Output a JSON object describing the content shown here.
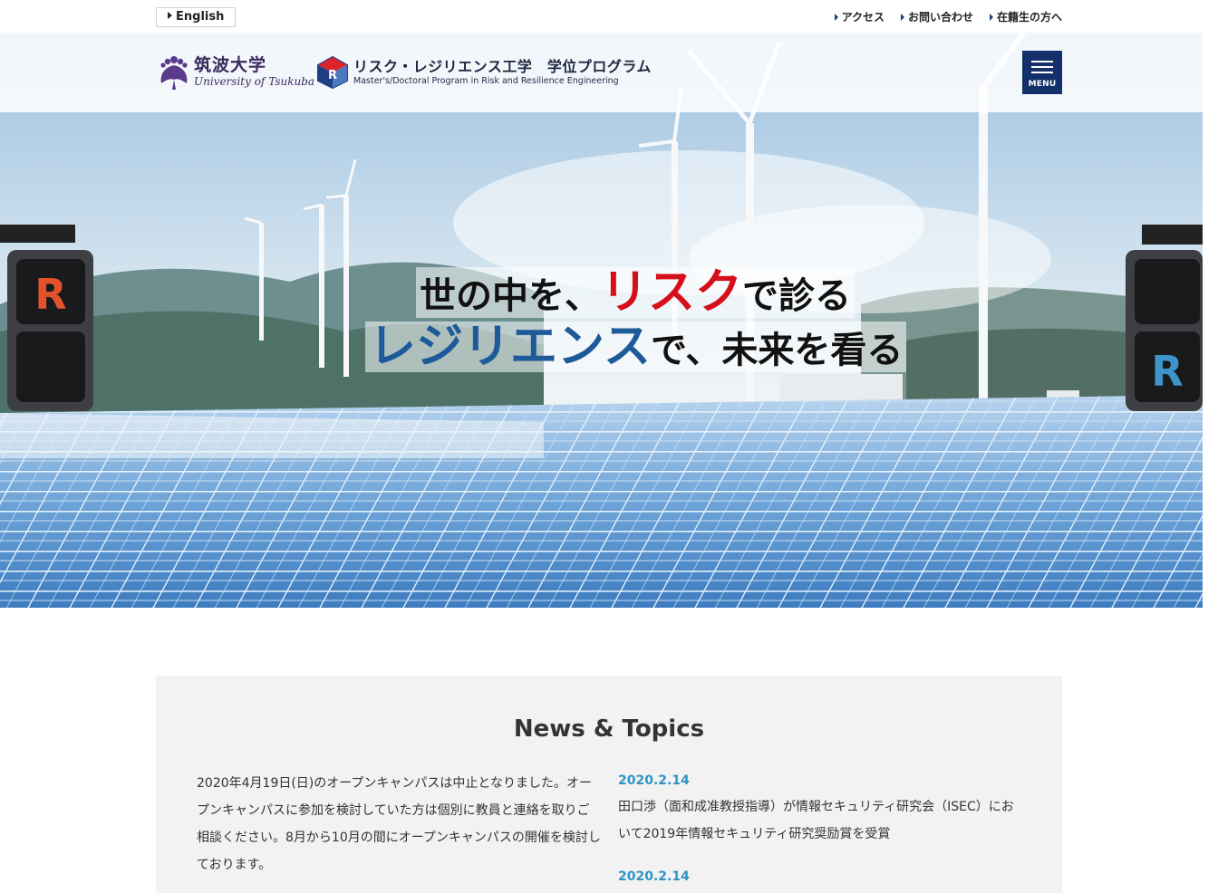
{
  "topbar": {
    "language_label": "English",
    "links": [
      "アクセス",
      "お問い合わせ",
      "在籍生の方へ"
    ]
  },
  "header": {
    "university_name_jp": "筑波大学",
    "university_name_en": "University of Tsukuba",
    "program_name_jp": "リスク・レジリエンス工学　学位プログラム",
    "program_name_en": "Master's/Doctoral Program in Risk and Resilience Engineering",
    "menu_label": "MENU"
  },
  "hero": {
    "line1_pre": "世の中を、",
    "line1_accent": "リスク",
    "line1_post": "で診る",
    "line2_accent": "レジリエンス",
    "line2_post": "で、未来を看る"
  },
  "news": {
    "title": "News & Topics",
    "notice": "2020年4月19日(日)のオープンキャンパスは中止となりました。オープンキャンパスに参加を検討していた方は個別に教員と連絡を取りご相談ください。8月から10月の間にオープンキャンパスの開催を検討しております。",
    "items": [
      {
        "date": "2020.2.14",
        "text": "田口渉（面和成准教授指導）が情報セキュリティ研究会（ISEC）において2019年情報セキュリティ研究奨励賞を受賞"
      },
      {
        "date": "2020.2.14",
        "text": ""
      }
    ]
  },
  "colors": {
    "brand_navy": "#13306a",
    "accent_red": "#d5101b",
    "accent_blue": "#1d5a9a",
    "date_blue": "#2f95c8"
  }
}
